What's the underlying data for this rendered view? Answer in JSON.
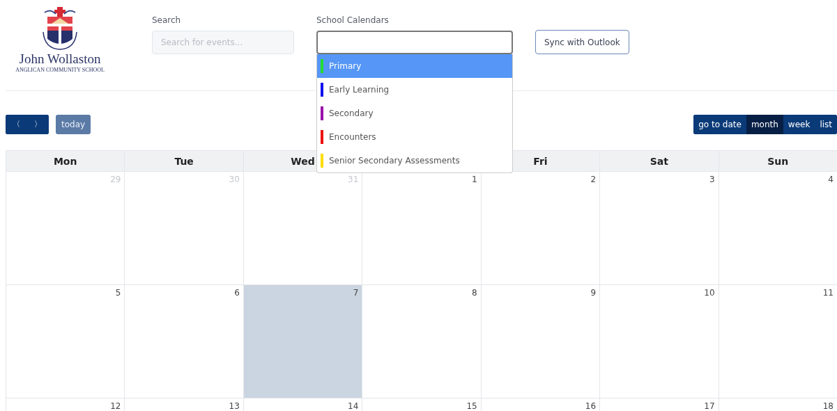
{
  "logo": {
    "name": "John Wollaston",
    "subtitle": "ANGLICAN COMMUNITY SCHOOL"
  },
  "search": {
    "label": "Search",
    "placeholder": "Search for events..."
  },
  "calendars": {
    "label": "School Calendars",
    "expanded": true,
    "options": [
      {
        "label": "Primary",
        "color": "#22dd33",
        "selected": true
      },
      {
        "label": "Early Learning",
        "color": "#1111ee",
        "selected": false
      },
      {
        "label": "Secondary",
        "color": "#9911aa",
        "selected": false
      },
      {
        "label": "Encounters",
        "color": "#ee1111",
        "selected": false
      },
      {
        "label": "Senior Secondary Assessments",
        "color": "#ffdd00",
        "selected": false
      }
    ]
  },
  "sync_button": "Sync with Outlook",
  "nav": {
    "prev": "〈",
    "next": "〉",
    "today": "today"
  },
  "views": [
    {
      "label": "go to date",
      "selected": false
    },
    {
      "label": "month",
      "selected": true
    },
    {
      "label": "week",
      "selected": false
    },
    {
      "label": "list",
      "selected": false
    }
  ],
  "weekdays_before_dropdown": [
    "Mon",
    "Tue",
    "Wed"
  ],
  "weekdays_after_dropdown": [
    "Fri",
    "Sat",
    "Sun"
  ],
  "weeks": [
    [
      {
        "day": "29",
        "other_month": true,
        "today": false
      },
      {
        "day": "30",
        "other_month": true,
        "today": false
      },
      {
        "day": "31",
        "other_month": true,
        "today": false
      },
      {
        "day": "1",
        "other_month": false,
        "today": false
      },
      {
        "day": "2",
        "other_month": false,
        "today": false
      },
      {
        "day": "3",
        "other_month": false,
        "today": false
      },
      {
        "day": "4",
        "other_month": false,
        "today": false
      }
    ],
    [
      {
        "day": "5",
        "other_month": false,
        "today": false
      },
      {
        "day": "6",
        "other_month": false,
        "today": false
      },
      {
        "day": "7",
        "other_month": false,
        "today": true
      },
      {
        "day": "8",
        "other_month": false,
        "today": false
      },
      {
        "day": "9",
        "other_month": false,
        "today": false
      },
      {
        "day": "10",
        "other_month": false,
        "today": false
      },
      {
        "day": "11",
        "other_month": false,
        "today": false
      }
    ],
    [
      {
        "day": "12",
        "other_month": false,
        "today": false
      },
      {
        "day": "13",
        "other_month": false,
        "today": false
      },
      {
        "day": "14",
        "other_month": false,
        "today": false
      },
      {
        "day": "15",
        "other_month": false,
        "today": false
      },
      {
        "day": "16",
        "other_month": false,
        "today": false
      },
      {
        "day": "17",
        "other_month": false,
        "today": false
      },
      {
        "day": "18",
        "other_month": false,
        "today": false
      }
    ]
  ]
}
